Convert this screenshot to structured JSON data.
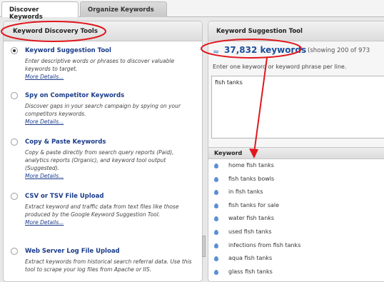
{
  "tabs": [
    {
      "label": "Discover Keywords"
    },
    {
      "label": "Organize Keywords"
    }
  ],
  "left_panel": {
    "title": "Keyword Discovery Tools",
    "tools": [
      {
        "title": "Keyword Suggestion Tool",
        "description": "Enter descriptive words or phrases to discover valuable keywords to target.",
        "more": "More Details...",
        "selected": true
      },
      {
        "title": "Spy on Competitor Keywords",
        "description": "Discover gaps in your search campaign by spying on your competitors keywords.",
        "more": "More Details...",
        "selected": false
      },
      {
        "title": "Copy & Paste Keywords",
        "description": "Copy & paste directly from search query reports (Paid), analytics reports (Organic), and keyword tool output (Suggested).",
        "more": "More Details...",
        "selected": false
      },
      {
        "title": "CSV or TSV File Upload",
        "description": "Extract keyword and traffic data from text files like those produced by the Google Keyword Suggestion Tool.",
        "more": "More Details...",
        "selected": false
      },
      {
        "title": "Web Server Log File Upload",
        "description": "Extract keywords from historical search referral data. Use this tool to scrape your log files from Apache or IIS.",
        "more": "",
        "selected": false
      }
    ]
  },
  "right_panel": {
    "title": "Keyword Suggestion Tool",
    "keyword_count": "37,832 keywords",
    "showing": "(showing 200 of 973",
    "instruction": "Enter one keyword or keyword phrase per line.",
    "input_value": "fish tanks",
    "table_header": "Keyword",
    "keywords": [
      "home fish tanks",
      "fish tanks bowls",
      "in fish tanks",
      "fish tanks for sale",
      "water fish tanks",
      "used fish tanks",
      "infections from fish tanks",
      "aqua fish tanks",
      "glass fish tanks"
    ]
  },
  "colors": {
    "annotation": "#e0181e",
    "link": "#1a3b8a",
    "count": "#1d4f9c"
  }
}
